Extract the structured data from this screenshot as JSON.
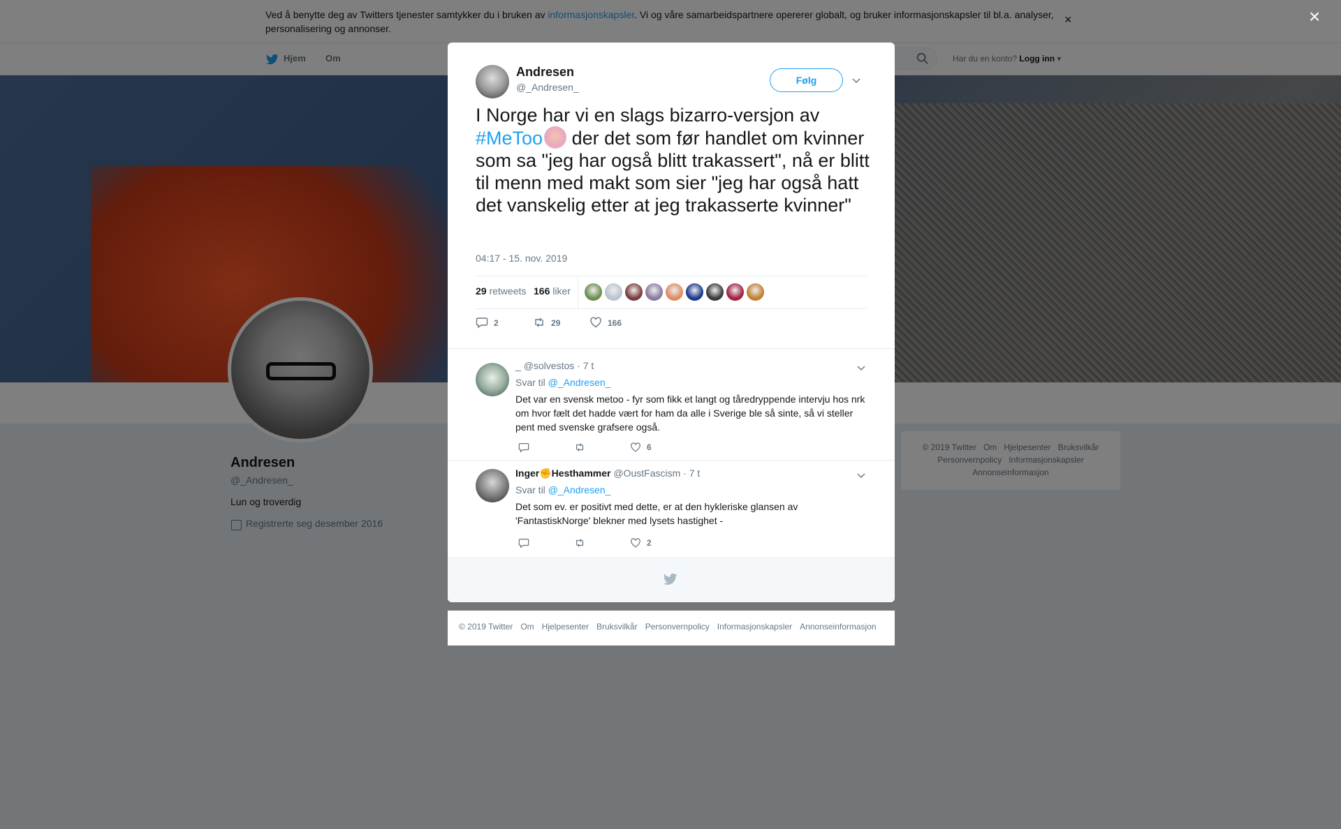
{
  "cookie_banner": {
    "text_before": "Ved å benytte deg av Twitters tjenester samtykker du i bruken av ",
    "link": "informasjonskapsler",
    "text_after": ". Vi og våre samarbeidspartnere opererer globalt, og bruker informasjonskapsler til bl.a. analyser, personalisering og annonser.",
    "close": "×"
  },
  "nav": {
    "home": "Hjem",
    "about": "Om",
    "login_prompt": "Har du en konto?",
    "login": "Logg inn"
  },
  "profile": {
    "name": "Andresen",
    "handle": "@_Andresen_",
    "bio": "Lun og troverdig",
    "joined": "Registrerte seg desember 2016"
  },
  "side_footer": [
    "© 2019 Twitter",
    "Om",
    "Hjelpesenter",
    "Bruksvilkår",
    "Personvernpolicy",
    "Informasjonskapsler",
    "Annonseinformasjon"
  ],
  "overlay": {
    "close": "×"
  },
  "tweet": {
    "author_name": "Andresen",
    "author_handle": "@_Andresen_",
    "follow": "Følg",
    "text_1": "I Norge har vi en slags bizarro-versjon av ",
    "hashtag": "#MeToo",
    "text_2": " der det som før handlet om kvinner som sa \"jeg har også blitt trakassert\", nå er blitt til menn med makt som sier \"jeg har også hatt det vanskelig etter at jeg trakasserte kvinner\"",
    "timestamp": "04:17 - 15. nov. 2019",
    "retweets_count": "29",
    "retweets_label": "retweets",
    "likes_count": "166",
    "likes_label": "liker",
    "liker_colors": [
      "#6b8e4e",
      "#b8c4d0",
      "#7a3b3b",
      "#8a7aa0",
      "#e08a60",
      "#1b3a8c",
      "#3a3a3a",
      "#a02040",
      "#c08030"
    ],
    "action_replies": "2",
    "action_retweets": "29",
    "action_likes": "166"
  },
  "replies": [
    {
      "name": "_",
      "handle": "@solvestos",
      "time": "· 7 t",
      "reply_to_label": "Svar til",
      "reply_to": "@_Andresen_",
      "text": "Det var en svensk metoo - fyr som fikk et langt og tåredryppende intervju hos nrk om hvor fælt det hadde vært for ham da alle i Sverige ble så sinte, så vi steller pent med svenske grafsere også.",
      "replies": "",
      "retweets": "",
      "likes": "6"
    },
    {
      "name": "Inger✊Hesthammer",
      "handle": "@OustFascism",
      "time": "· 7 t",
      "reply_to_label": "Svar til",
      "reply_to": "@_Andresen_",
      "text": "Det som ev. er positivt med dette, er at den hykleriske glansen av 'FantastiskNorge' blekner med lysets hastighet -",
      "replies": "",
      "retweets": "",
      "likes": "2"
    }
  ],
  "modal_footer": [
    "© 2019 Twitter",
    "Om",
    "Hjelpesenter",
    "Bruksvilkår",
    "Personvernpolicy",
    "Informasjonskapsler",
    "Annonseinformasjon"
  ],
  "colors": {
    "accent": "#1da1f2",
    "text": "#14171a",
    "muted": "#657786",
    "overlay": "rgba(0,0,0,0.5)"
  }
}
